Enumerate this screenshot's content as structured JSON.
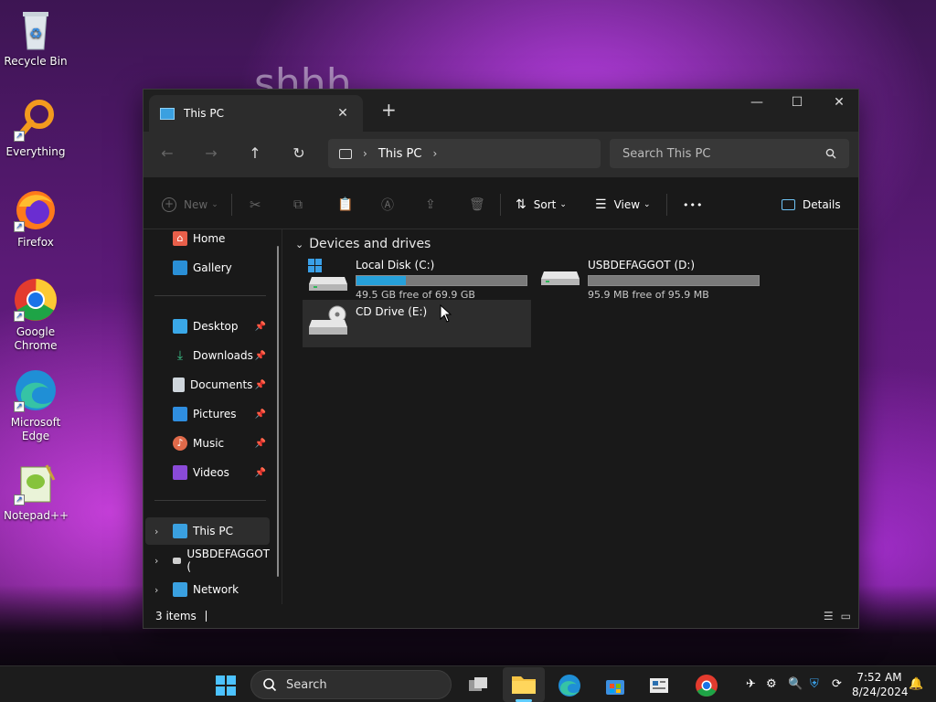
{
  "desktop": {
    "bg_text": "shhh",
    "icons": [
      {
        "label": "Recycle Bin"
      },
      {
        "label": "Everything"
      },
      {
        "label": "Firefox"
      },
      {
        "label": "Google Chrome"
      },
      {
        "label": "Microsoft Edge"
      },
      {
        "label": "Notepad++"
      }
    ]
  },
  "window": {
    "tab_title": "This PC",
    "tab_close": "✕",
    "new_tab": "+",
    "controls": {
      "minimize": "—",
      "maximize": "☐",
      "close": "✕"
    },
    "nav": {
      "back": "←",
      "forward": "→",
      "up": "↑",
      "refresh": "↻"
    },
    "address": {
      "segment": "This PC",
      "sep": "›"
    },
    "search_placeholder": "Search This PC",
    "toolbar": {
      "new": "New",
      "sort": "Sort",
      "view": "View",
      "more": "•••",
      "details": "Details"
    },
    "sidebar": {
      "home": "Home",
      "gallery": "Gallery",
      "pinned": [
        {
          "label": "Desktop"
        },
        {
          "label": "Downloads"
        },
        {
          "label": "Documents"
        },
        {
          "label": "Pictures"
        },
        {
          "label": "Music"
        },
        {
          "label": "Videos"
        }
      ],
      "this_pc": "This PC",
      "usb": "USBDEFAGGOT (",
      "network": "Network"
    },
    "main": {
      "group_title": "Devices and drives",
      "drives": [
        {
          "name": "Local Disk (C:)",
          "free": "49.5 GB free of 69.9 GB",
          "used_fraction": 0.29
        },
        {
          "name": "USBDEFAGGOT (D:)",
          "free": "95.9 MB free of 95.9 MB",
          "used_fraction": 0.0
        },
        {
          "name": "CD Drive (E:)"
        }
      ]
    },
    "status": "3 items"
  },
  "taskbar": {
    "search": "Search",
    "time": "7:52 AM",
    "date": "8/24/2024"
  }
}
